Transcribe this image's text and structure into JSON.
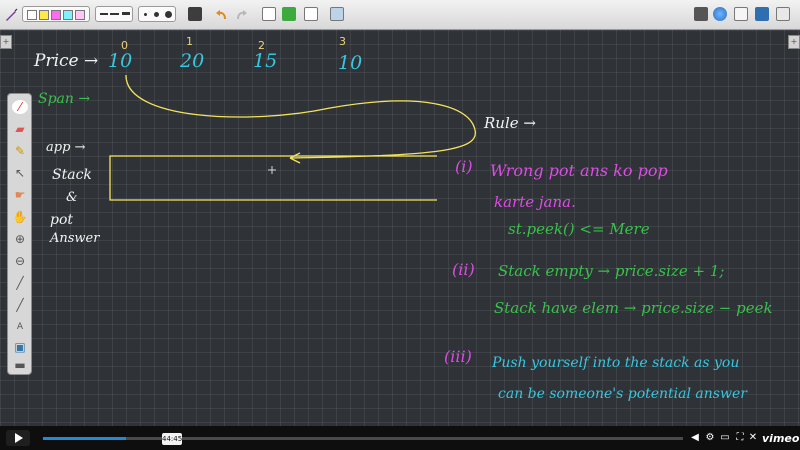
{
  "board": {
    "indices": [
      "0",
      "1",
      "2",
      "3"
    ],
    "price_label": "Price →",
    "prices": [
      "10",
      "20",
      "15",
      "10"
    ],
    "span_label": "Span →",
    "app_label": "app →",
    "stack_label": "Stack",
    "amp_label": "&",
    "pot_label": "pot",
    "answer_label": "Answer",
    "rule_label": "Rule →",
    "rule1_num": "(i)",
    "rule1_line1": "Wrong pot ans ko pop",
    "rule1_line2": "karte jana.",
    "rule1_code": "st.peek() <= Mere",
    "rule2_num": "(ii)",
    "rule2_line1": "Stack empty → price.size + 1;",
    "rule2_line2": "Stack have elem → price.size − peek",
    "rule3_num": "(iii)",
    "rule3_line1": "Push yourself into the stack as you",
    "rule3_line2": "can be someone's potential answer"
  },
  "player": {
    "time": "44:45",
    "brand": "vimeo",
    "progress": 0.13
  },
  "colors": {
    "cyan": "#37c6e0",
    "green": "#37c24a",
    "magenta": "#e04ae8",
    "white": "#f3f3f3",
    "yellow": "#f4e45c",
    "index": "#f0d27a",
    "accent": "#1f8ad6"
  },
  "icons": [
    "pen-tool-icon",
    "color-palette-icon",
    "line-style-icon",
    "dot-size-icon",
    "keyboard-icon",
    "undo-icon",
    "redo-icon",
    "add-page-icon",
    "copy-page-icon",
    "paste-page-icon",
    "screen-capture-icon",
    "board-mode-icon",
    "web-icon",
    "documents-icon",
    "desktop-icon",
    "settings-icon",
    "close-icon",
    "play-icon",
    "volume-icon",
    "gear-icon",
    "pip-icon",
    "fullscreen-icon"
  ]
}
